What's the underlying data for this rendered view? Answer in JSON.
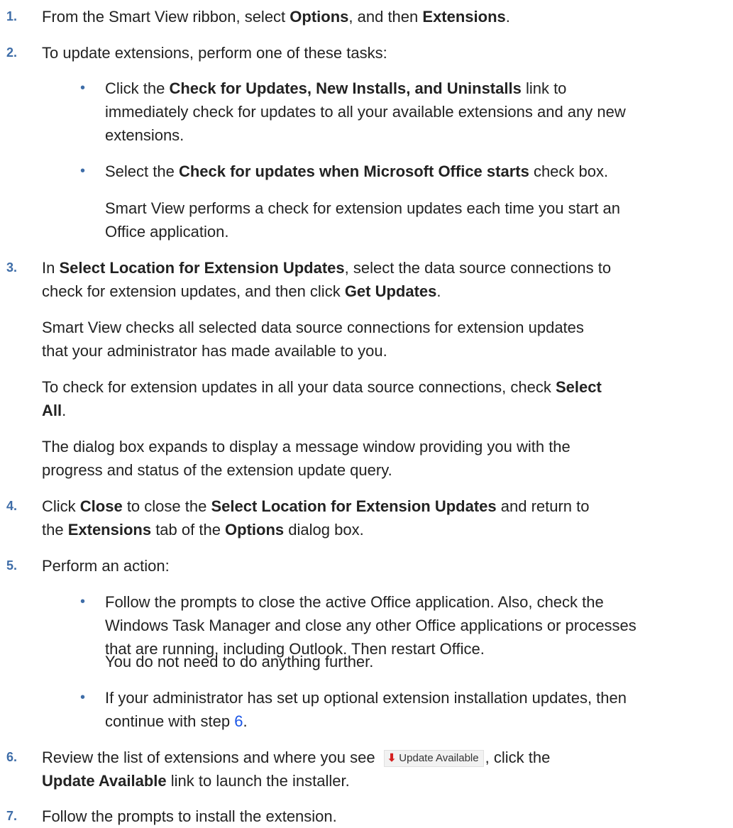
{
  "steps": [
    {
      "num": "1.",
      "a": "From the Smart View ribbon, select ",
      "b1": "Options",
      "c": ", and then ",
      "b2": "Extensions",
      "d": "."
    },
    {
      "num": "2.",
      "text": "To update extensions, perform one of these tasks:",
      "bullet1": {
        "pre": "Click the ",
        "bold": "Check for Updates, New Installs, and Uninstalls",
        "post": " link to",
        "line2": "immediately check for updates to all your available extensions and any new",
        "line3": "extensions."
      },
      "bullet2": {
        "pre": "Select the ",
        "bold": "Check for updates when Microsoft Office starts",
        "post": " check box.",
        "note1": "Smart View performs a check for extension updates each time you start an",
        "note2": "Office application."
      }
    },
    {
      "num": "3.",
      "pre": "In ",
      "bold1": "Select Location for Extension Updates",
      "mid": ", select the data source connections to",
      "line2pre": "check for extension updates, and then click ",
      "bold2": "Get Updates",
      "line2post": ".",
      "p1l1": "Smart View checks all selected data source connections for extension updates",
      "p1l2": "that your administrator has made available to you.",
      "p2pre": "To check for extension updates in all your data source connections, check ",
      "p2bold1": "Select",
      "p2bold2": "All",
      "p2post": ".",
      "p3l1": "The dialog box expands to display a message window providing you with the",
      "p3l2": "progress and status of the extension update query."
    },
    {
      "num": "4.",
      "pre": "Click ",
      "bold1": "Close",
      "mid1": " to close the ",
      "bold2": "Select Location for Extension Updates",
      "mid2": " and return to",
      "line2pre": "the ",
      "bold3": "Extensions",
      "line2mid": " tab of the ",
      "bold4": "Options",
      "line2post": " dialog box."
    },
    {
      "num": "5.",
      "text": "Perform an action:",
      "bullet1": {
        "l1": "Follow the prompts to close the active Office application. Also, check the",
        "l2": "Windows Task Manager and close any other Office applications or processes",
        "l3": "that are running, including Outlook. Then restart Office.",
        "note": "You do not need to do anything further."
      },
      "bullet2": {
        "l1": "If your administrator has set up optional extension installation updates, then",
        "l2pre": "continue with step ",
        "link": "6",
        "l2post": "."
      }
    },
    {
      "num": "6.",
      "pre": "Review the list of extensions and where you see ",
      "badge": "Update Available",
      "post": ", click the",
      "line2bold": "Update Available",
      "line2post": " link to launch the installer."
    },
    {
      "num": "7.",
      "text": "Follow the prompts to install the extension."
    }
  ],
  "bullet_glyph": "•",
  "badge_arrow": "⬇",
  "colors": {
    "number": "#3e6da8",
    "link": "#1a55e6",
    "badge_arrow": "#d41f1f"
  }
}
